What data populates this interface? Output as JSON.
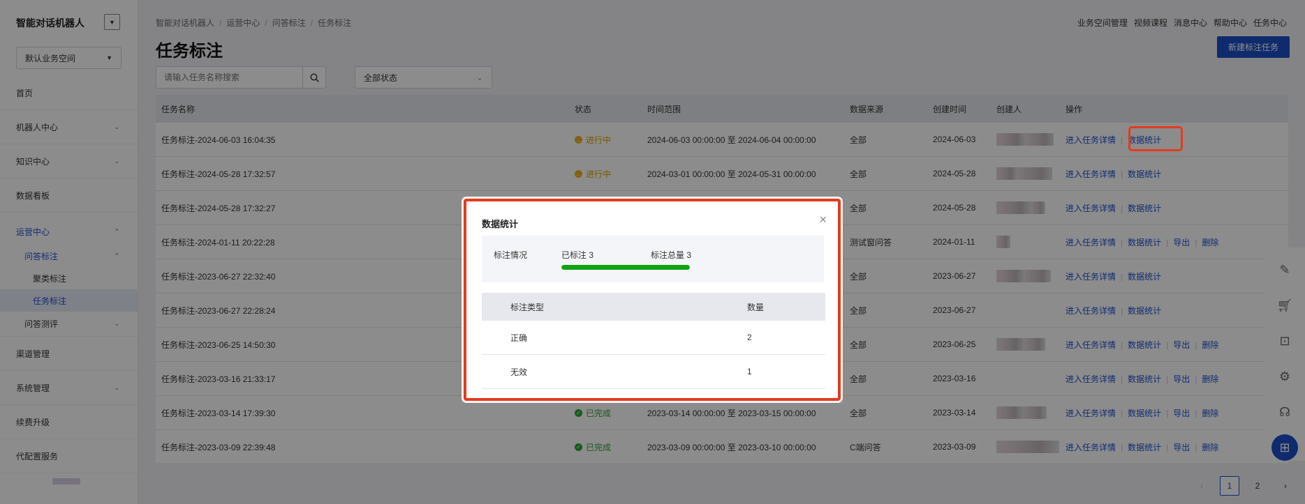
{
  "sidebar": {
    "app_title": "智能对话机器人",
    "workspace": "默认业务空间",
    "items": [
      {
        "label": "首页"
      },
      {
        "label": "机器人中心"
      },
      {
        "label": "知识中心"
      },
      {
        "label": "数据看板"
      },
      {
        "label": "运营中心"
      },
      {
        "label": "问答标注"
      },
      {
        "label": "聚类标注"
      },
      {
        "label": "任务标注"
      },
      {
        "label": "问答测评"
      },
      {
        "label": "渠道管理"
      },
      {
        "label": "系统管理"
      },
      {
        "label": "续费升级"
      },
      {
        "label": "代配置服务"
      }
    ]
  },
  "breadcrumb": [
    "智能对话机器人",
    "运营中心",
    "问答标注",
    "任务标注"
  ],
  "breadcrumb_sep": "/",
  "top_links": [
    "业务空间管理",
    "视频课程",
    "消息中心",
    "帮助中心",
    "任务中心"
  ],
  "page_title": "任务标注",
  "new_button": "新建标注任务",
  "search": {
    "placeholder": "请输入任务名称搜索"
  },
  "status_filter": "全部状态",
  "table": {
    "headers": [
      "任务名称",
      "状态",
      "时间范围",
      "数据来源",
      "创建时间",
      "创建人",
      "操作"
    ],
    "rows": [
      {
        "name": "任务标注-2024-06-03 16:04:35",
        "status": "进行中",
        "range": "2024-06-03 00:00:00 至 2024-06-04 00:00:00",
        "source": "全部",
        "created": "2024-06-03",
        "ops": [
          "进入任务详情",
          "数据统计"
        ]
      },
      {
        "name": "任务标注-2024-05-28 17:32:57",
        "status": "进行中",
        "range": "2024-03-01 00:00:00 至 2024-05-31 00:00:00",
        "source": "全部",
        "created": "2024-05-28",
        "ops": [
          "进入任务详情",
          "数据统计"
        ]
      },
      {
        "name": "任务标注-2024-05-28 17:32:27",
        "status": "",
        "range": "",
        "source": "全部",
        "created": "2024-05-28",
        "ops": [
          "进入任务详情",
          "数据统计"
        ]
      },
      {
        "name": "任务标注-2024-01-11 20:22:28",
        "status": "",
        "range": "",
        "source": "测试窗问答",
        "created": "2024-01-11",
        "ops": [
          "进入任务详情",
          "数据统计",
          "导出",
          "删除"
        ]
      },
      {
        "name": "任务标注-2023-06-27 22:32:40",
        "status": "",
        "range": "",
        "source": "全部",
        "created": "2023-06-27",
        "ops": [
          "进入任务详情",
          "数据统计"
        ]
      },
      {
        "name": "任务标注-2023-06-27 22:28:24",
        "status": "",
        "range": "",
        "source": "全部",
        "created": "2023-06-27",
        "ops": [
          "进入任务详情",
          "数据统计"
        ]
      },
      {
        "name": "任务标注-2023-06-25 14:50:30",
        "status": "",
        "range": "",
        "source": "全部",
        "created": "2023-06-25",
        "ops": [
          "进入任务详情",
          "数据统计",
          "导出",
          "删除"
        ]
      },
      {
        "name": "任务标注-2023-03-16 21:33:17",
        "status": "",
        "range": "",
        "source": "全部",
        "created": "2023-03-16",
        "ops": [
          "进入任务详情",
          "数据统计",
          "导出",
          "删除"
        ]
      },
      {
        "name": "任务标注-2023-03-14 17:39:30",
        "status": "已完成",
        "range": "2023-03-14 00:00:00 至 2023-03-15 00:00:00",
        "source": "全部",
        "created": "2023-03-14",
        "ops": [
          "进入任务详情",
          "数据统计",
          "导出",
          "删除"
        ]
      },
      {
        "name": "任务标注-2023-03-09 22:39:48",
        "status": "已完成",
        "range": "2023-03-09 00:00:00 至 2023-03-10 00:00:00",
        "source": "C端问答",
        "created": "2023-03-09",
        "ops": [
          "进入任务详情",
          "数据统计",
          "导出",
          "删除"
        ]
      }
    ]
  },
  "pager": {
    "prev": "‹",
    "pages": [
      "1",
      "2"
    ],
    "next": "›"
  },
  "modal": {
    "title": "数据统计",
    "close": "×",
    "summary_label": "标注情况",
    "done_text": "已标注 3",
    "total_text": "标注总量 3",
    "progress_fraction": 1.0,
    "table_headers": [
      "标注类型",
      "数量"
    ],
    "rows": [
      {
        "type": "正确",
        "count": "2"
      },
      {
        "type": "无效",
        "count": "1"
      }
    ]
  },
  "colors": {
    "accent": "#1d4fc9",
    "highlight": "#e23c1f",
    "progress": "#12a312",
    "running": "#f2b01e",
    "done": "#2fa43a"
  }
}
